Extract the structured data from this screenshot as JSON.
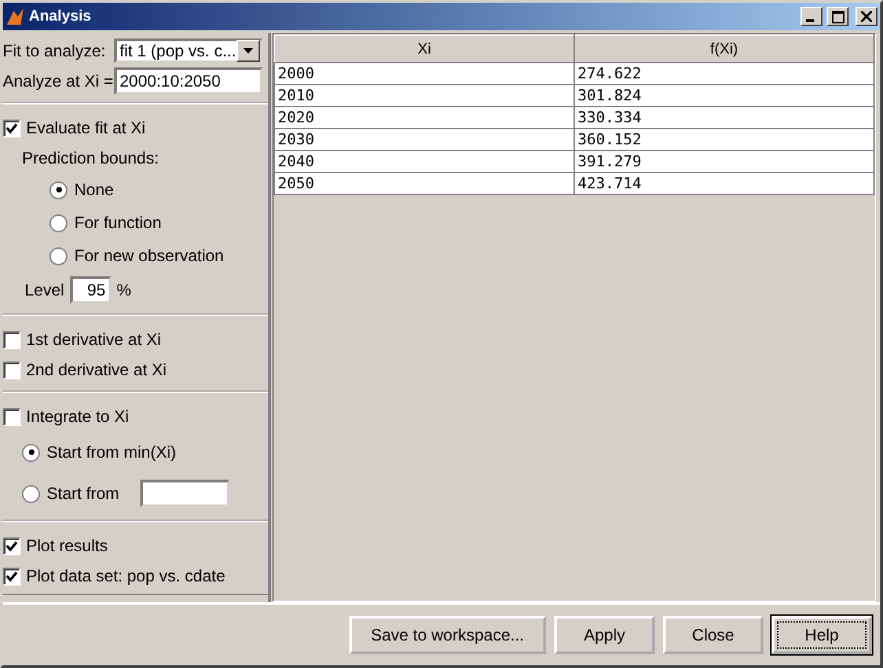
{
  "window": {
    "title": "Analysis"
  },
  "fit_selector": {
    "label": "Fit to analyze:",
    "value": "fit 1 (pop vs. c..."
  },
  "xi_field": {
    "label": "Analyze at Xi =",
    "value": "2000:10:2050"
  },
  "evaluate": {
    "label": "Evaluate fit at Xi",
    "checked": true
  },
  "prediction_bounds": {
    "label": "Prediction bounds:",
    "options": [
      {
        "label": "None",
        "selected": true
      },
      {
        "label": "For function",
        "selected": false
      },
      {
        "label": "For new observation",
        "selected": false
      }
    ]
  },
  "level": {
    "label": "Level",
    "value": "95",
    "unit": "%"
  },
  "derivatives": [
    {
      "label": "1st derivative at Xi",
      "checked": false
    },
    {
      "label": "2nd derivative at Xi",
      "checked": false
    }
  ],
  "integrate": {
    "label": "Integrate to Xi",
    "checked": false,
    "start_options": [
      {
        "kind": "plain",
        "label": "Start from min(Xi)",
        "selected": true
      },
      {
        "kind": "field",
        "label": "Start from",
        "selected": false
      }
    ]
  },
  "plot_options": [
    {
      "label": "Plot results",
      "checked": true
    },
    {
      "label": "Plot data set: pop vs. cdate",
      "checked": true
    }
  ],
  "table": {
    "columns": [
      "Xi",
      "f(Xi)"
    ],
    "rows": [
      [
        "2000",
        "274.622"
      ],
      [
        "2010",
        "301.824"
      ],
      [
        "2020",
        "330.334"
      ],
      [
        "2030",
        "360.152"
      ],
      [
        "2040",
        "391.279"
      ],
      [
        "2050",
        "423.714"
      ]
    ]
  },
  "buttons": [
    {
      "label": "Save to workspace...",
      "focused": false
    },
    {
      "label": "Apply",
      "focused": false
    },
    {
      "label": "Close",
      "focused": false
    },
    {
      "label": "Help",
      "focused": true
    }
  ]
}
